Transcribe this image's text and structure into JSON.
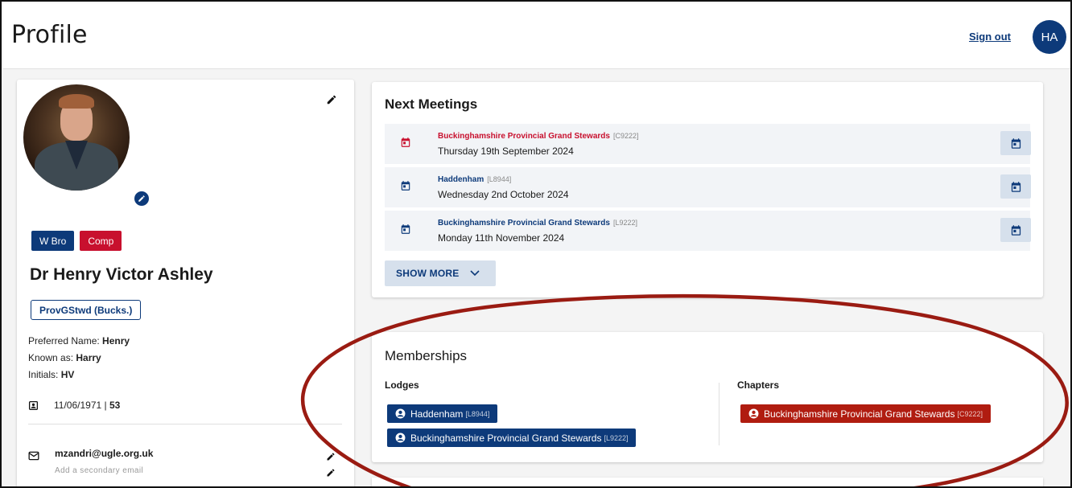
{
  "header": {
    "title": "Profile",
    "sign_out_label": "Sign out",
    "avatar_initials": "HA"
  },
  "profile": {
    "badges": [
      {
        "label": "W Bro",
        "color": "#0d3a7a"
      },
      {
        "label": "Comp",
        "color": "#c8102e"
      }
    ],
    "full_name": "Dr Henry Victor Ashley",
    "rank": "ProvGStwd (Bucks.)",
    "preferred_name_label": "Preferred Name: ",
    "preferred_name": "Henry",
    "known_as_label": "Known as: ",
    "known_as": "Harry",
    "initials_label": "Initials: ",
    "initials": "HV",
    "dob": "11/06/1971 | ",
    "age": "53",
    "email": "mzandri@ugle.org.uk",
    "secondary_email_placeholder": "Add a secondary email"
  },
  "next_meetings": {
    "title": "Next Meetings",
    "items": [
      {
        "name": "Buckinghamshire Provincial Grand Stewards",
        "code": "[C9222]",
        "date": "Thursday 19th September 2024",
        "color": "#c8102e"
      },
      {
        "name": "Haddenham",
        "code": "[L8944]",
        "date": "Wednesday 2nd October 2024",
        "color": "#0d3a7a"
      },
      {
        "name": "Buckinghamshire Provincial Grand Stewards",
        "code": "[L9222]",
        "date": "Monday 11th November 2024",
        "color": "#0d3a7a"
      }
    ],
    "show_more_label": "SHOW MORE"
  },
  "memberships": {
    "title": "Memberships",
    "lodges_label": "Lodges",
    "chapters_label": "Chapters",
    "lodges": [
      {
        "name": "Haddenham",
        "code": "[L8944]"
      },
      {
        "name": "Buckinghamshire Provincial Grand Stewards",
        "code": "[L9222]"
      }
    ],
    "chapters": [
      {
        "name": "Buckinghamshire Provincial Grand Stewards",
        "code": "[C9222]"
      }
    ]
  },
  "colors": {
    "primary": "#0d3a7a",
    "accent_red": "#c8102e",
    "annotation": "#9a1b12"
  }
}
